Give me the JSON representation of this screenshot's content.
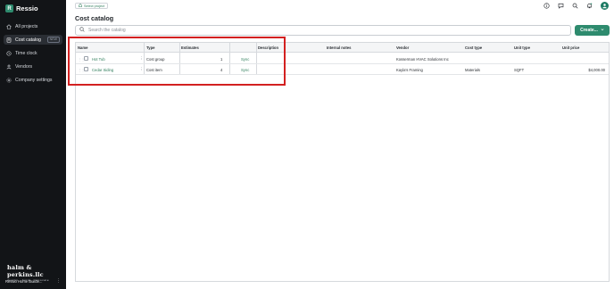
{
  "app": {
    "name": "Ressio",
    "logo_letter": "R"
  },
  "sidebar": {
    "items": [
      {
        "label": "All projects",
        "icon": "home-icon",
        "active": false
      },
      {
        "label": "Cost catalog",
        "icon": "book-icon",
        "active": true,
        "badge": "NEW"
      },
      {
        "label": "Time clock",
        "icon": "clock-icon",
        "active": false
      },
      {
        "label": "Vendors",
        "icon": "vendors-icon",
        "active": false
      },
      {
        "label": "Company settings",
        "icon": "gear-icon",
        "active": false
      }
    ],
    "company_logo": {
      "line1": "halm & perkins.llc",
      "line2": "design · build · renovate"
    },
    "account": {
      "name": "Ressio Home Builde...",
      "more": "⋮"
    }
  },
  "topbar": {
    "project_select": "Select project",
    "icons": [
      "help-icon",
      "chat-icon",
      "search-icon",
      "bell-icon"
    ]
  },
  "page": {
    "title": "Cost catalog",
    "search_placeholder": "Search the catalog",
    "create_label": "Create..."
  },
  "table": {
    "columns": [
      "Name",
      "Type",
      "Estimates",
      "Description",
      "Internal notes",
      "Vendor",
      "Cost type",
      "Unit type",
      "Unit price"
    ],
    "rows": [
      {
        "name": "Hot Tub",
        "type": "Cost group",
        "estimates": "1",
        "sync": "Sync",
        "description": "",
        "internal_notes": "",
        "vendor": "Kosserman HVAC Solutions Inc",
        "cost_type": "",
        "unit_type": "",
        "unit_price": ""
      },
      {
        "name": "Cedar Siding",
        "type": "Cost item",
        "estimates": "4",
        "sync": "Sync",
        "description": "",
        "internal_notes": "",
        "vendor": "Kayla's Framing",
        "cost_type": "Materials",
        "unit_type": "SQFT",
        "unit_price": "$4,000.00"
      }
    ]
  },
  "colors": {
    "accent": "#2e8b6e",
    "sidebar_bg": "#121417",
    "highlight": "#d32020"
  }
}
